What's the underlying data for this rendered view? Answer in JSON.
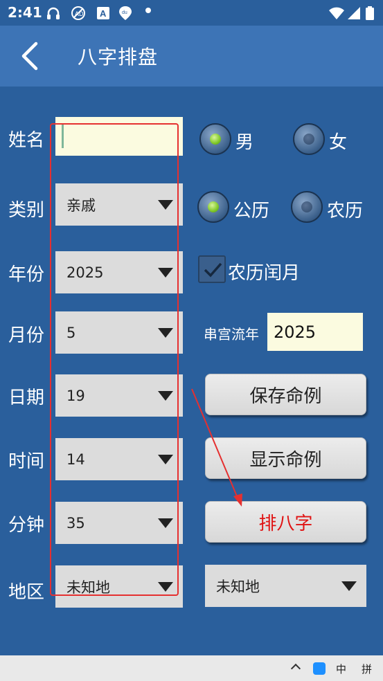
{
  "status_bar": {
    "time": "2:41",
    "icons": [
      "headset-icon",
      "no-sync-icon",
      "font-a-icon",
      "location-pin-icon",
      "notification-dot-icon",
      "wifi-icon",
      "signal-icon",
      "battery-icon"
    ]
  },
  "app_bar": {
    "title": "八字排盘",
    "back_icon": "chevron-left-icon"
  },
  "form": {
    "name": {
      "label": "姓名",
      "value": ""
    },
    "gender": {
      "male_label": "男",
      "female_label": "女",
      "selected": "男"
    },
    "category": {
      "label": "类别",
      "value": "亲戚"
    },
    "calendar": {
      "solar_label": "公历",
      "lunar_label": "农历",
      "selected": "公历"
    },
    "year": {
      "label": "年份",
      "value": "2025"
    },
    "leap_month": {
      "label": "农历闰月",
      "checked": true
    },
    "month": {
      "label": "月份",
      "value": "5"
    },
    "liunian": {
      "label": "串宫流年",
      "value": "2025"
    },
    "day": {
      "label": "日期",
      "value": "19"
    },
    "hour": {
      "label": "时间",
      "value": "14"
    },
    "minute": {
      "label": "分钟",
      "value": "35"
    },
    "region": {
      "label": "地区",
      "value": "未知地",
      "sub_value": "未知地"
    }
  },
  "buttons": {
    "save": "保存命例",
    "show": "显示命例",
    "bazi": "排八字"
  },
  "nav_bar": {
    "ime_zh": "中",
    "ime_pinyin": "拼"
  },
  "colors": {
    "background": "#2a5f9c",
    "app_bar": "#3d74b6",
    "highlight_red": "#e53030",
    "button_text_red": "#e01212",
    "input_bg": "#fbfbe0"
  }
}
